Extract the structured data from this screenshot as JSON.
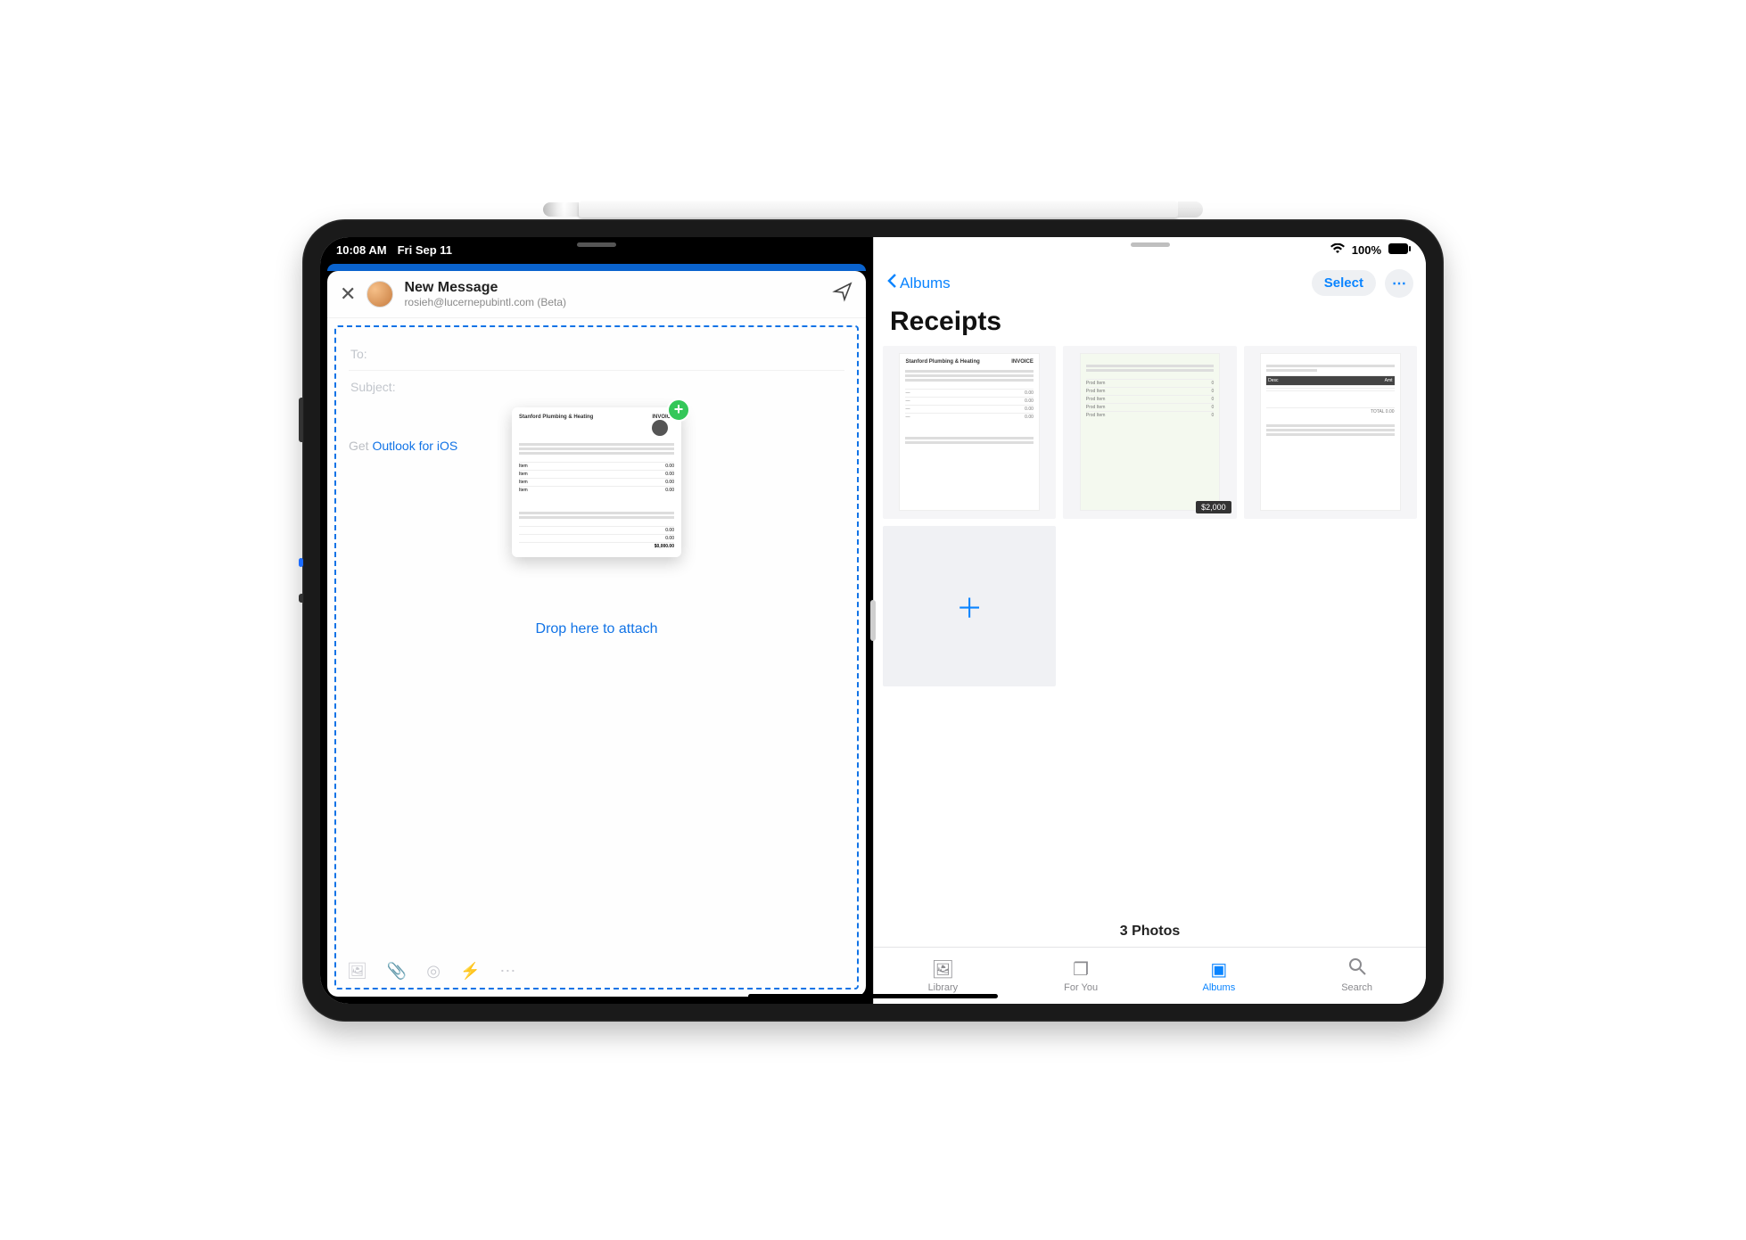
{
  "status": {
    "time": "10:08 AM",
    "date": "Fri Sep 11",
    "battery": "100%"
  },
  "outlook": {
    "title": "New Message",
    "from": "rosieh@lucernepubintl.com (Beta)",
    "to_label": "To:",
    "subject_label": "Subject:",
    "signature_static": "Get ",
    "signature_link": "Outlook for iOS",
    "drop_hint": "Drop here to attach",
    "drag_doc_title": "Stanford Plumbing & Heating"
  },
  "photos": {
    "back_label": "Albums",
    "select_label": "Select",
    "album_title": "Receipts",
    "count_label": "3 Photos",
    "thumbs": [
      {
        "title": "Stanford Plumbing & Heating",
        "tag": "INVOICE"
      },
      {
        "title": "",
        "badge": "$2,000"
      },
      {
        "title": ""
      }
    ],
    "tabs": {
      "library": "Library",
      "foryou": "For You",
      "albums": "Albums",
      "search": "Search"
    }
  }
}
